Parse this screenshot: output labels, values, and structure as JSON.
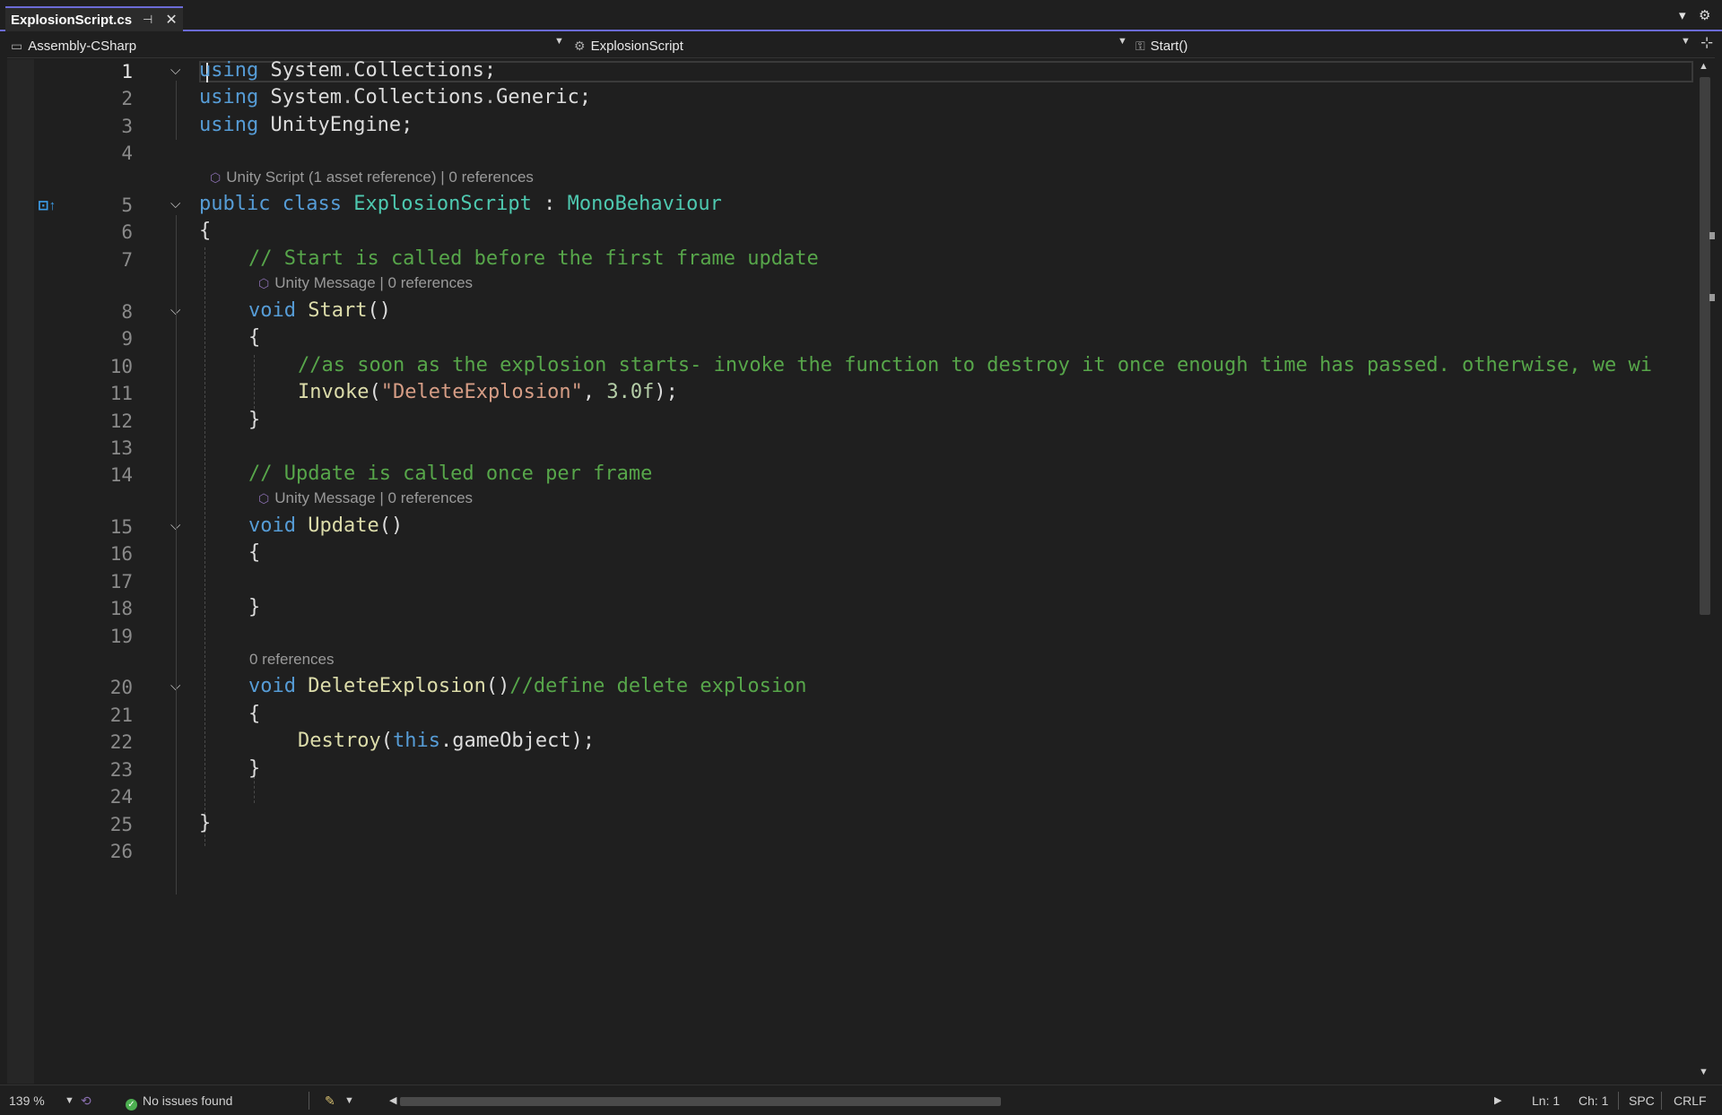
{
  "tab": {
    "title": "ExplosionScript.cs",
    "pin_icon": "pin-icon",
    "close_icon": "close-icon"
  },
  "navbar": {
    "project": "Assembly-CSharp",
    "type": "ExplosionScript",
    "member": "Start()"
  },
  "editor": {
    "line_numbers": [
      "1",
      "2",
      "3",
      "4",
      "5",
      "6",
      "7",
      "8",
      "9",
      "10",
      "11",
      "12",
      "13",
      "14",
      "15",
      "16",
      "17",
      "18",
      "19",
      "20",
      "21",
      "22",
      "23",
      "24",
      "25",
      "26"
    ],
    "code": {
      "l1a": "using",
      "l1b": " System",
      "l1c": ".",
      "l1d": "Collections;",
      "l2a": "using",
      "l2b": " System",
      "l2c": ".",
      "l2d": "Collections",
      "l2e": ".",
      "l2f": "Generic;",
      "l3a": "using",
      "l3b": " UnityEngine;",
      "l5a": "public",
      "l5b": " ",
      "l5c": "class",
      "l5d": " ",
      "l5e": "ExplosionScript",
      "l5f": " : ",
      "l5g": "MonoBehaviour",
      "l6": "{",
      "l7": "// Start is called before the first frame update",
      "l8a": "void",
      "l8b": " ",
      "l8c": "Start",
      "l8d": "()",
      "l9": "{",
      "l10": "//as soon as the explosion starts- invoke the function to destroy it once enough time has passed. otherwise, we wi",
      "l11a": "Invoke",
      "l11b": "(",
      "l11c": "\"DeleteExplosion\"",
      "l11d": ", ",
      "l11e": "3.0f",
      "l11f": ");",
      "l12": "}",
      "l14": "// Update is called once per frame",
      "l15a": "void",
      "l15b": " ",
      "l15c": "Update",
      "l15d": "()",
      "l16": "{",
      "l18": "}",
      "l20a": "void",
      "l20b": " ",
      "l20c": "DeleteExplosion",
      "l20d": "()",
      "l20e": "//define delete explosion",
      "l21": "{",
      "l22a": "Destroy",
      "l22b": "(",
      "l22c": "this",
      "l22d": ".gameObject);",
      "l23": "}",
      "l25": "}"
    },
    "codelens": {
      "class": "Unity Script (1 asset reference) | 0 references",
      "start": "Unity Message | 0 references",
      "update": "Unity Message | 0 references",
      "delete": "0 references"
    }
  },
  "statusbar": {
    "zoom": "139 %",
    "issues": "No issues found",
    "line": "Ln: 1",
    "char": "Ch: 1",
    "whitespace": "SPC",
    "line_ending": "CRLF"
  }
}
